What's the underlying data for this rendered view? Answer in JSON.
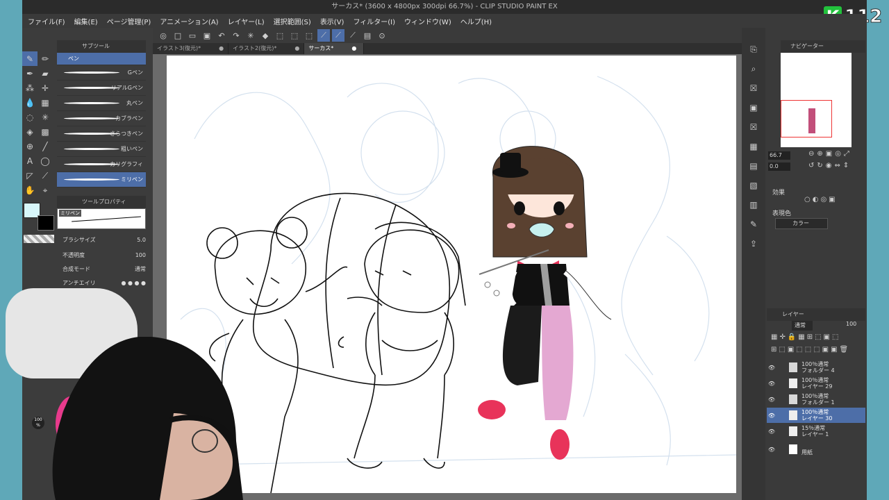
{
  "window": {
    "title": "サーカス* (3600 x 4800px 300dpi 66.7%)  - CLIP STUDIO PAINT EX"
  },
  "menu": [
    "ファイル(F)",
    "編集(E)",
    "ページ管理(P)",
    "アニメーション(A)",
    "レイヤー(L)",
    "選択範囲(S)",
    "表示(V)",
    "フィルター(I)",
    "ウィンドウ(W)",
    "ヘルプ(H)"
  ],
  "tabs": [
    {
      "label": "イラスト3(復元)*"
    },
    {
      "label": "イラスト2(復元)*"
    },
    {
      "label": "サーカス*",
      "active": true
    }
  ],
  "subtool": {
    "header": "サブツール",
    "active_label": "ペン",
    "items": [
      "Gペン",
      "リアルGペン",
      "丸ペン",
      "カブラペン",
      "さらつきペン",
      "粗いペン",
      "カリグラフィ",
      "ミリペン"
    ],
    "selected_index": 7
  },
  "toolprop": {
    "header": "ツールプロパティ",
    "brush_name": "ミリペン",
    "brush_size_label": "ブラシサイズ",
    "brush_size_value": "5.0",
    "opacity_label": "不透明度",
    "opacity_value": "100",
    "blend_label": "合成モード",
    "blend_value": "通常",
    "antialias_label": "アンチエイリ"
  },
  "colors": {
    "main": "#d7f7fa",
    "sub": "#000000",
    "accent": "#4d6ea8"
  },
  "color_wheel": {
    "opacity_value": "100",
    "opacity_unit": "%"
  },
  "navigator": {
    "header": "ナビゲーター",
    "zoom": "66.7",
    "rotate": "0.0"
  },
  "effect": {
    "header": "効果",
    "display_color_label": "表現色",
    "display_color_value": "カラー"
  },
  "layers": {
    "header": "レイヤー",
    "blend": "通常",
    "opacity": "100",
    "items": [
      {
        "line1": "100％通常",
        "line2": "フォルダー 4",
        "type": "folder"
      },
      {
        "line1": "100％通常",
        "line2": "レイヤー 29",
        "type": "layer"
      },
      {
        "line1": "100％通常",
        "line2": "フォルダー 1",
        "type": "folder"
      },
      {
        "line1": "100％通常",
        "line2": "レイヤー 30",
        "type": "layer",
        "selected": true
      },
      {
        "line1": "15％通常",
        "line2": "レイヤー 1",
        "type": "layer"
      },
      {
        "line1": "",
        "line2": "用紙",
        "type": "paper"
      }
    ]
  },
  "stream": {
    "channel_letter": "K",
    "channel_number": "112"
  }
}
